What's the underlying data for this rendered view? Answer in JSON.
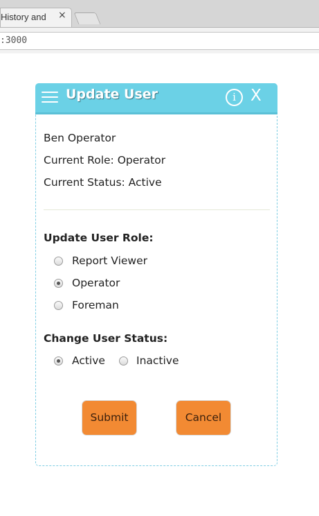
{
  "browser": {
    "tab_title": "History and",
    "tab_close": "×",
    "url": ":3000"
  },
  "modal": {
    "title": "Update User",
    "info_glyph": "i",
    "close_glyph": "X",
    "user_name": "Ben Operator",
    "current_role": "Current Role: Operator",
    "current_status": "Current Status: Active",
    "role_section": {
      "label": "Update User Role:",
      "options": [
        {
          "label": "Report Viewer",
          "checked": false
        },
        {
          "label": "Operator",
          "checked": true
        },
        {
          "label": "Foreman",
          "checked": false
        }
      ]
    },
    "status_section": {
      "label": "Change User Status:",
      "options": [
        {
          "label": "Active",
          "checked": true
        },
        {
          "label": "Inactive",
          "checked": false
        }
      ]
    },
    "submit_label": "Submit",
    "cancel_label": "Cancel"
  },
  "colors": {
    "header_bg": "#6bd1e6",
    "button_bg": "#f28a33"
  },
  "icons": [
    "hamburger-icon",
    "info-icon",
    "close-icon",
    "tab-close-icon"
  ]
}
